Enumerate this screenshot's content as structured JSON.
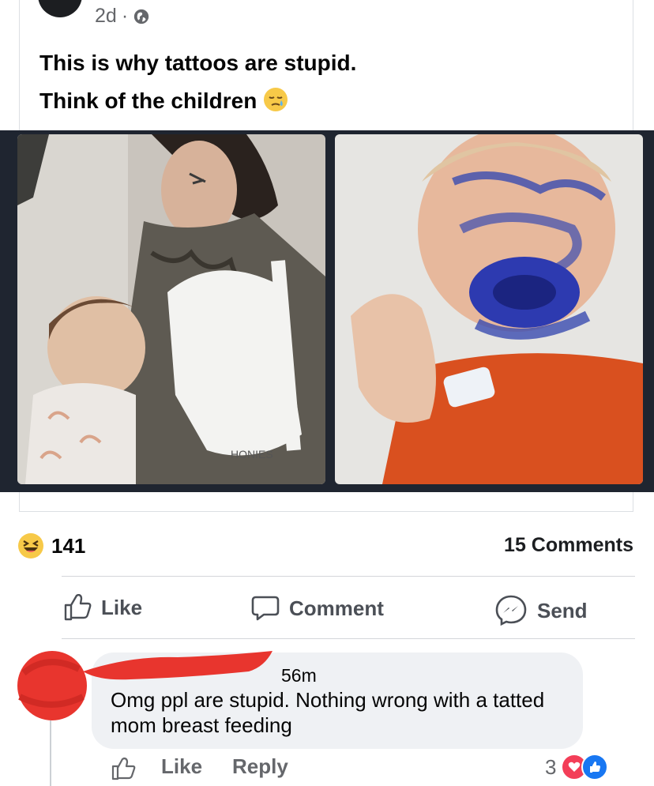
{
  "post": {
    "time": "2d",
    "separator": "·",
    "privacy_icon": "globe-icon",
    "text_line1": "This is why tattoos are stupid.",
    "text_line2": "Think of the children"
  },
  "stats": {
    "reaction_count": "141",
    "comments_count": "15 Comments",
    "reaction_icon": "haha-emoji-icon"
  },
  "actions": {
    "like": "Like",
    "comment": "Comment",
    "send": "Send"
  },
  "comment": {
    "time": "56m",
    "text": "Omg ppl are stupid. Nothing wrong with a tatted mom breast feeding",
    "like": "Like",
    "reply": "Reply",
    "reaction_count": "3"
  },
  "colors": {
    "accent_blue": "#1877f2",
    "love_red": "#f33e58",
    "redaction_red": "#e8352e"
  },
  "images": {
    "left_caption_text": "HONIES"
  }
}
